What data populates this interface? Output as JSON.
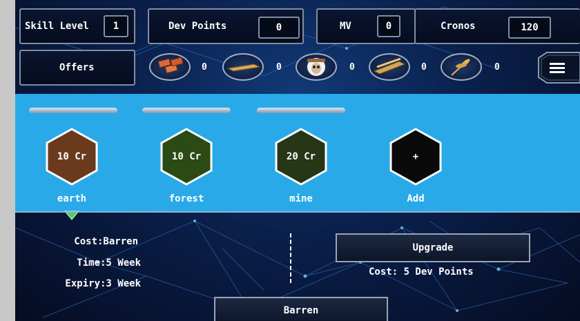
{
  "stats": {
    "skill_level_label": "Skill Level",
    "skill_level_value": "1",
    "dev_points_label": "Dev Points",
    "dev_points_value": "0",
    "mv_label": "MV",
    "mv_value": "0",
    "cronos_label": "Cronos",
    "cronos_value": "120"
  },
  "offers_label": "Offers",
  "resources": [
    {
      "icon": "bricks-icon",
      "count": "0"
    },
    {
      "icon": "lumber-board-icon",
      "count": "0"
    },
    {
      "icon": "sheep-icon",
      "count": "0"
    },
    {
      "icon": "logs-icon",
      "count": "0"
    },
    {
      "icon": "wheat-icon",
      "count": "0"
    }
  ],
  "menu_icon": "hamburger-menu-icon",
  "lands": [
    {
      "cost": "10 Cr",
      "name": "earth",
      "color": "#6b3a1c"
    },
    {
      "cost": "10 Cr",
      "name": "forest",
      "color": "#2b4a14"
    },
    {
      "cost": "20 Cr",
      "name": "mine",
      "color": "#263616"
    },
    {
      "cost": "+",
      "name": "Add",
      "color": "#0a0a0a"
    }
  ],
  "details": {
    "cost": "Cost:Barren",
    "time": "Time:5 Week",
    "expiry": "Expiry:3 Week"
  },
  "upgrade_label": "Upgrade",
  "upgrade_cost": "Cost: 5 Dev Points",
  "bottom_button": "Barren",
  "colors": {
    "band": "#29a9e8",
    "selected_arrow": "#4fd05a"
  }
}
